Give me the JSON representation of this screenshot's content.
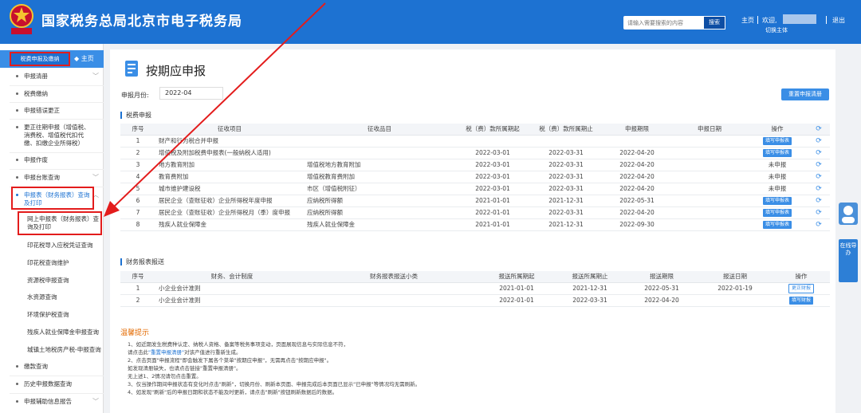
{
  "header": {
    "site_title": "国家税务总局北京市电子税务局",
    "emblem_text": "中国税务",
    "search_placeholder": "请输入需要搜索的内容",
    "search_label": "搜索",
    "home_link": "主页",
    "welcome": "欢迎,",
    "logout": "退出",
    "switch_user": "切换主体",
    "header_color": "#1d72d2"
  },
  "sidebar": {
    "top_tab": "税费申报及缴纳",
    "home": "主页",
    "items": [
      {
        "label": "申报清册",
        "chevron": true
      },
      {
        "label": "税费缴纳",
        "chevron": false
      },
      {
        "label": "申报错误更正",
        "chevron": false
      },
      {
        "label_lines": [
          "更正往期申报（增值税、",
          "消费税、增值税代扣代",
          "缴、扣缴企业所得税）"
        ],
        "chevron": false
      },
      {
        "label": "申报作废",
        "chevron": false
      },
      {
        "label": "申报台账查询",
        "chevron": true
      },
      {
        "label_lines": [
          "申报表（财务报表）查询",
          "及打印"
        ],
        "chevron": true,
        "highlighted": true
      }
    ],
    "subitems": [
      {
        "label_lines": [
          "网上申报表（财务报表）查",
          "询及打印"
        ],
        "highlighted": true
      },
      {
        "label": "印花税导入应税凭证查询"
      },
      {
        "label": "印花税查询维护"
      },
      {
        "label": "资源税申报查询"
      },
      {
        "label": "水资源查询"
      },
      {
        "label": "环境保护税查询"
      },
      {
        "label": "残疾人就业保障金申报查询"
      },
      {
        "label": "城镇土地税房产税-申报查询"
      }
    ],
    "bottom_items": [
      {
        "label": "缴款查询",
        "chevron": false
      },
      {
        "label": "历史申报数据查询",
        "chevron": false
      },
      {
        "label": "申报辅助信息报告",
        "chevron": true
      }
    ]
  },
  "main": {
    "title": "按期应申报",
    "month_label": "申报月份:",
    "month_value": "2022-04",
    "reset_button": "重置申报清册",
    "tax_section": "税费申报",
    "tax_headers": [
      "序号",
      "征收项目",
      "征收品目",
      "税（费）款所属期起",
      "税（费）款所属期止",
      "申报期限",
      "申报日期",
      "操作"
    ],
    "tax_rows": [
      {
        "no": "1",
        "item": "财产和行为税合并申报",
        "sub": "",
        "start": "",
        "end": "",
        "deadline": "",
        "date": "",
        "op": "填写申报表",
        "op_type": "button"
      },
      {
        "no": "2",
        "item": "增值税及附加税费申报表(一般纳税人适用)",
        "sub": "",
        "start": "2022-03-01",
        "end": "2022-03-31",
        "deadline": "2022-04-20",
        "date": "",
        "op": "填写申报表",
        "op_type": "button"
      },
      {
        "no": "3",
        "item": "地方教育附加",
        "sub": "增值税地方教育附加",
        "start": "2022-03-01",
        "end": "2022-03-31",
        "deadline": "2022-04-20",
        "date": "",
        "op": "未申报",
        "op_type": "text"
      },
      {
        "no": "4",
        "item": "教育费附加",
        "sub": "增值税教育费附加",
        "start": "2022-03-01",
        "end": "2022-03-31",
        "deadline": "2022-04-20",
        "date": "",
        "op": "未申报",
        "op_type": "text"
      },
      {
        "no": "5",
        "item": "城市维护建设税",
        "sub": "市区（增值税附征）",
        "start": "2022-03-01",
        "end": "2022-03-31",
        "deadline": "2022-04-20",
        "date": "",
        "op": "未申报",
        "op_type": "text"
      },
      {
        "no": "6",
        "item": "居民企业（查账征收）企业所得税年度申报",
        "sub": "应纳税所得额",
        "start": "2021-01-01",
        "end": "2021-12-31",
        "deadline": "2022-05-31",
        "date": "",
        "op": "填写申报表",
        "op_type": "button"
      },
      {
        "no": "7",
        "item": "居民企业（查账征收）企业所得税月（季）度申报",
        "sub": "应纳税所得额",
        "start": "2022-01-01",
        "end": "2022-03-31",
        "deadline": "2022-04-20",
        "date": "",
        "op": "填写申报表",
        "op_type": "button"
      },
      {
        "no": "8",
        "item": "残疾人就业保障金",
        "sub": "残疾人就业保障金",
        "start": "2021-01-01",
        "end": "2021-12-31",
        "deadline": "2022-09-30",
        "date": "",
        "op": "填写申报表",
        "op_type": "button"
      }
    ],
    "fin_section": "财务报表报送",
    "fin_headers": [
      "序号",
      "财务、会计制度",
      "财务报表报送小类",
      "报送所属期起",
      "报送所属期止",
      "报送期限",
      "报送日期",
      "操作"
    ],
    "fin_rows": [
      {
        "no": "1",
        "system": "小企业会计准则",
        "sub": "",
        "start": "2021-01-01",
        "end": "2021-12-31",
        "deadline": "2022-05-31",
        "date": "2022-01-19",
        "op": "更正财报",
        "op_type": "outline"
      },
      {
        "no": "2",
        "system": "小企业会计准则",
        "sub": "",
        "start": "2022-01-01",
        "end": "2022-03-31",
        "deadline": "2022-04-20",
        "date": "",
        "op": "填写财报",
        "op_type": "button"
      }
    ],
    "tips_title": "温馨提示",
    "tips": [
      {
        "pre": "1、如近期发生税费种认定、纳税人资格、备案等税务事项变动，页面展现信息与实际信息不符，",
        "link": "",
        "post": ""
      },
      {
        "pre": "   请点击此",
        "link": "\"重置申报清册\"",
        "post": "对该产值进行重新生成。"
      },
      {
        "pre": "2、点击页面\"申报流程\"即会触发下属各个菜单\"按期应申报\"，无需再点击\"按期应申报\"。",
        "link": "",
        "post": ""
      },
      {
        "pre": "   如发现清册缺失，也请点击链接\"重置申报清册\"。",
        "link": "",
        "post": ""
      },
      {
        "pre": "   无上述1、2情况请勿点击重置。",
        "link": "",
        "post": ""
      },
      {
        "pre": "3、仅当操作期间申报状态有变化时点击\"刷新\"，切换月份、刷新本页面、申报完成后本页面已显示\"已申报\"等情况均无需刷新。",
        "link": "",
        "post": ""
      },
      {
        "pre": "4、如发现\"刷新\"后的申报日期和状态不能及时更新，请点击\"刷新\"按钮刷新数据后的数据。",
        "link": "",
        "post": ""
      }
    ]
  },
  "float_panel": {
    "label": "在线导办"
  }
}
